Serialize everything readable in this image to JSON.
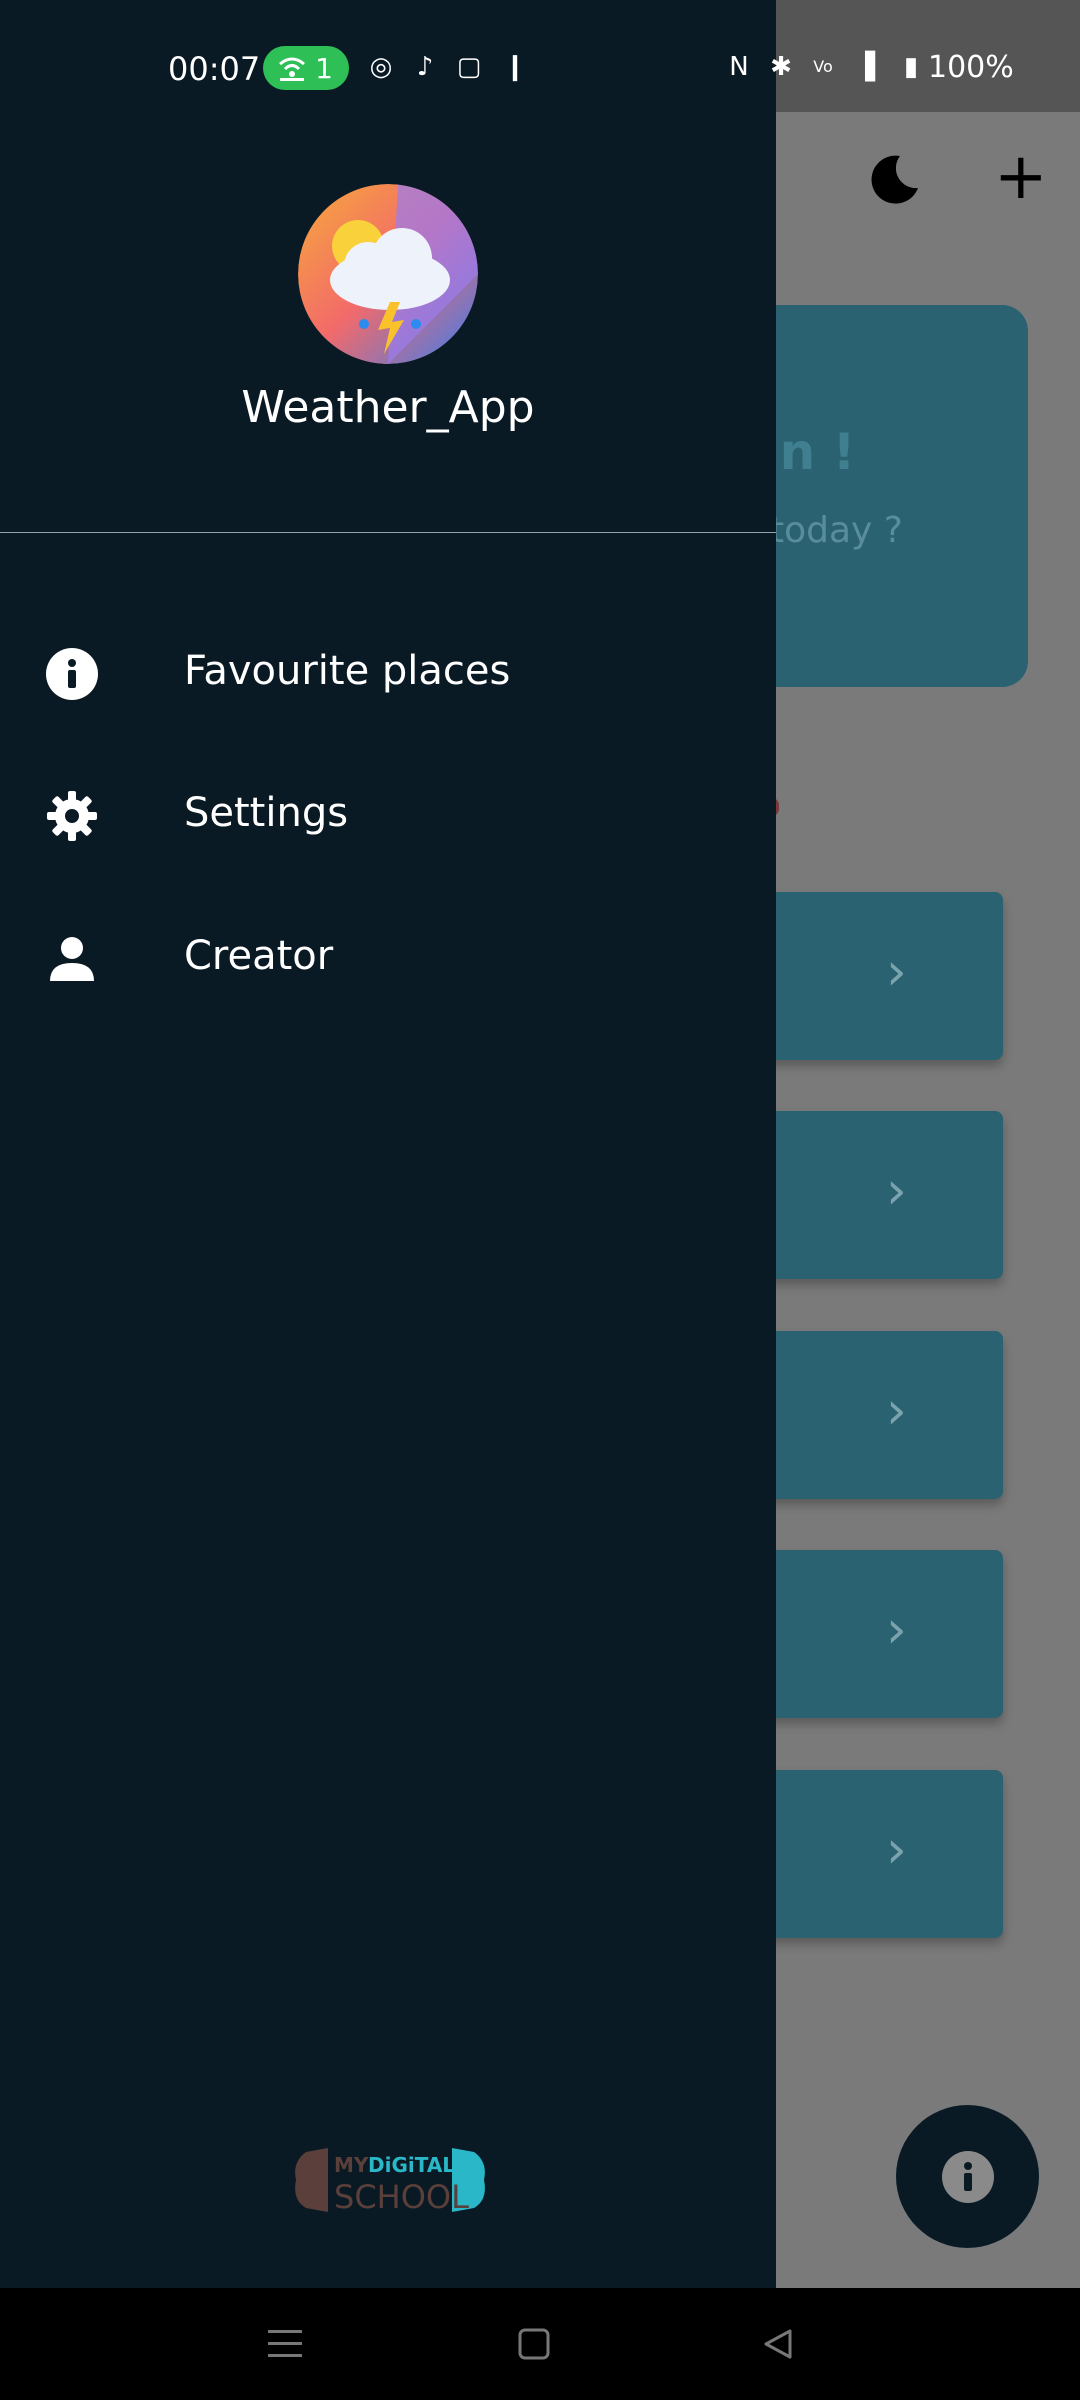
{
  "status_bar": {
    "time": "00:07",
    "hotspot_count": "1",
    "battery": "100%"
  },
  "drawer": {
    "app_name": "Weather_App",
    "items": [
      {
        "label": "Favourite places",
        "icon": "info-icon"
      },
      {
        "label": "Settings",
        "icon": "gear-icon"
      },
      {
        "label": "Creator",
        "icon": "person-icon"
      }
    ],
    "brand_logo_text": "MY DIGITAL SCHOOL"
  },
  "background": {
    "greeting": "tan !",
    "question": "today ?"
  },
  "colors": {
    "drawer_bg": "#0a1a24",
    "card_bg": "#2a6271",
    "hotspot_green": "#2fbf57"
  }
}
